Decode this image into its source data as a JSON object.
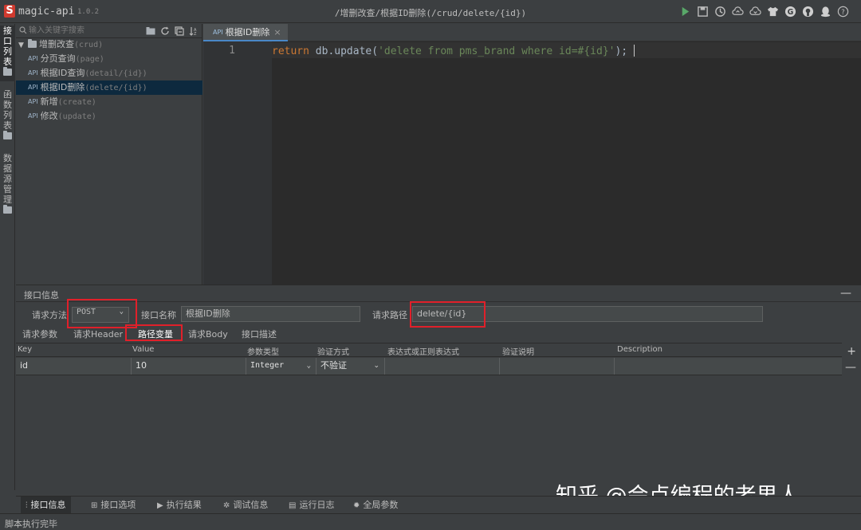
{
  "app": {
    "name": "magic-api",
    "version": "1.0.2",
    "breadcrumb": "/增删改查/根据ID删除(/crud/delete/{id})"
  },
  "toolbar_icons": [
    "run-icon",
    "save-icon",
    "history-icon",
    "upload-icon",
    "download-icon",
    "skin-icon",
    "gitee-icon",
    "github-icon",
    "qq-icon",
    "help-icon"
  ],
  "vertical_tabs": [
    {
      "label": "接口列表",
      "active": true
    },
    {
      "label": "函数列表",
      "active": false
    },
    {
      "label": "数据源管理",
      "active": false
    }
  ],
  "sidebar": {
    "search_placeholder": "输入关键字搜索",
    "group": {
      "name": "增删改查",
      "path": "(crud)"
    },
    "items": [
      {
        "badge": "API",
        "name": "分页查询",
        "path": "(page)"
      },
      {
        "badge": "API",
        "name": "根据ID查询",
        "path": "(detail/{id})"
      },
      {
        "badge": "API",
        "name": "根据ID删除",
        "path": "(delete/{id})",
        "selected": true
      },
      {
        "badge": "API",
        "name": "新增",
        "path": "(create)"
      },
      {
        "badge": "API",
        "name": "修改",
        "path": "(update)"
      }
    ]
  },
  "editor": {
    "tab": {
      "badge": "API",
      "label": "根据ID删除",
      "close": "×"
    },
    "line_number": "1",
    "code": {
      "keyword": "return",
      "call": " db.update(",
      "string": "'delete from pms_brand where id=#{id}'",
      "end": ");"
    }
  },
  "panel": {
    "title": "接口信息",
    "minimize": "—",
    "method_label": "请求方法",
    "method_value": "POST",
    "name_label": "接口名称",
    "name_value": "根据ID删除",
    "path_label": "请求路径",
    "path_value": "delete/{id}",
    "sub_tabs": [
      "请求参数",
      "请求Header",
      "路径变量",
      "请求Body",
      "接口描述"
    ],
    "active_sub_tab": 2,
    "columns": [
      "Key",
      "Value",
      "参数类型",
      "验证方式",
      "表达式或正则表达式",
      "验证说明",
      "Description"
    ],
    "rows": [
      {
        "key": "id",
        "value": "10",
        "type": "Integer",
        "validation": "不验证",
        "expression": "",
        "note": "",
        "description": ""
      }
    ],
    "add": "+",
    "remove": "—"
  },
  "bottom_tabs": [
    {
      "icon": "sliders-icon",
      "label": "接口信息",
      "active": true
    },
    {
      "icon": "grid-icon",
      "label": "接口选项",
      "active": false
    },
    {
      "icon": "play-icon",
      "label": "执行结果",
      "active": false
    },
    {
      "icon": "bug-icon",
      "label": "调试信息",
      "active": false
    },
    {
      "icon": "log-icon",
      "label": "运行日志",
      "active": false
    },
    {
      "icon": "settings-icon",
      "label": "全局参数",
      "active": false
    }
  ],
  "status": "脚本执行完毕",
  "watermark": "知乎 @会点编程的老男人",
  "colors": {
    "accent": "#4a88c7",
    "highlight_box": "#e0202a",
    "run": "#59a869",
    "selected_row": "#0d293e"
  }
}
